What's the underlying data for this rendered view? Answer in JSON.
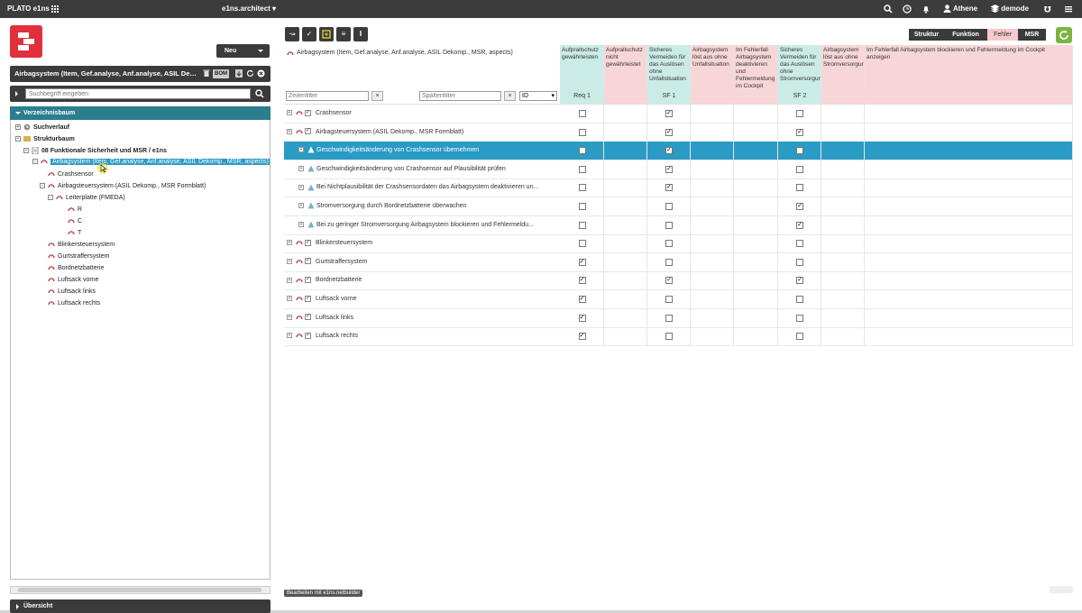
{
  "topbar": {
    "app_name": "PLATO e1ns",
    "module": "e1ns.architect",
    "user": "Athene",
    "database": "demode"
  },
  "left": {
    "new_button": "Neu",
    "context_title": "Airbagsystem (Item, Gef.analyse, Anf.analyse, ASIL Dekomp., MSR, aspects)",
    "bom_label": "BOM",
    "search_placeholder": "Suchbegriff eingeben",
    "tree_header": "Verzeichnisbaum",
    "overview_label": "Übersicht",
    "tree": [
      {
        "label": "Suchverlauf",
        "bold": true
      },
      {
        "label": "Strukturbaum",
        "bold": true
      },
      {
        "label": "08 Funktionale Sicherheit und MSR / e1ns",
        "bold": true
      },
      {
        "label": "Airbagsystem (Item, Gef.analyse, Anf.analyse, ASIL Dekomp., MSR, aspects)",
        "bold": false
      },
      {
        "label": "Crashsensor",
        "bold": false
      },
      {
        "label": "Airbagsteuersystem (ASIL Dekomp., MSR Formblatt)",
        "bold": false
      },
      {
        "label": "Leiterplatte (FMEDA)",
        "bold": false
      },
      {
        "label": "R",
        "bold": false
      },
      {
        "label": "C",
        "bold": false
      },
      {
        "label": "T",
        "bold": false
      },
      {
        "label": "Blinkersteuersystem",
        "bold": false
      },
      {
        "label": "Gurtstraffersystem",
        "bold": false
      },
      {
        "label": "Bordnetzbatterie",
        "bold": false
      },
      {
        "label": "Luftsack vorne",
        "bold": false
      },
      {
        "label": "Luftsack links",
        "bold": false
      },
      {
        "label": "Luftsack rechts",
        "bold": false
      }
    ]
  },
  "views": [
    "Struktur",
    "Funktion",
    "Fehler",
    "MSR"
  ],
  "grid": {
    "title": "Airbagsystem (Item, Gef.analyse, Anf.analyse, ASIL Dekomp., MSR, aspects)",
    "row_filter_placeholder": "Zeilenfilter",
    "col_filter_placeholder": "Spaltenfilter",
    "id_select": "ID",
    "columns": [
      {
        "header": "Aufprallschutz gewährleisten",
        "tag": "Req 1",
        "color": "teal"
      },
      {
        "header": "Aufprallschutz nicht gewährleistet",
        "tag": "",
        "color": "pink"
      },
      {
        "header": "Sicheres Vermeiden für das Auslösen ohne Unfallsituation",
        "tag": "SF 1",
        "color": "teal"
      },
      {
        "header": "Airbagsystem löst aus ohne Unfallsituation",
        "tag": "",
        "color": "pink"
      },
      {
        "header": "Im Fehlerfall Airbagsystem deaktivieren und Fehlermeldung im Cockpit anzeigen",
        "tag": "",
        "color": "pink"
      },
      {
        "header": "Sicheres Vermeiden für das Auslösen ohne Stromversorgung",
        "tag": "SF 2",
        "color": "teal"
      },
      {
        "header": "Airbagsystem löst aus ohne Stromversorgung",
        "tag": "",
        "color": "pink"
      },
      {
        "header": "Im Fehlerfall Airbagsystem blockieren und Fehlermeldung im Cockpit anzeigen",
        "tag": "",
        "color": "pink"
      }
    ],
    "rows": [
      {
        "label": "Crashsensor",
        "type": "item",
        "indent": 0,
        "checks": [
          false,
          null,
          true,
          null,
          null,
          false,
          null,
          null
        ]
      },
      {
        "label": "Airbagsteuersystem (ASIL Dekomp., MSR Formblatt)",
        "type": "item",
        "indent": 0,
        "checks": [
          false,
          null,
          true,
          null,
          null,
          true,
          null,
          null
        ]
      },
      {
        "label": "Geschwindigkeitsänderung von Crashsensor übernehmen",
        "type": "req",
        "indent": 1,
        "selected": true,
        "checks": [
          false,
          null,
          true,
          null,
          null,
          false,
          null,
          null
        ]
      },
      {
        "label": "Geschwindigkeitsänderung von Crashsensor auf Plausibilität prüfen",
        "type": "req",
        "indent": 1,
        "checks": [
          false,
          null,
          true,
          null,
          null,
          false,
          null,
          null
        ]
      },
      {
        "label": "Bei Nichtplausibilität der Crashsensordaten das Airbagsystem deaktivieren un...",
        "type": "req",
        "indent": 1,
        "checks": [
          false,
          null,
          true,
          null,
          null,
          false,
          null,
          null
        ]
      },
      {
        "label": "Stromversorgung durch Bordnetzbatterie überwachen",
        "type": "req",
        "indent": 1,
        "checks": [
          false,
          null,
          false,
          null,
          null,
          true,
          null,
          null
        ]
      },
      {
        "label": "Bei zu geringer Stromversorgung Airbagsystem blockieren und Fehlermeldu...",
        "type": "req",
        "indent": 1,
        "checks": [
          false,
          null,
          false,
          null,
          null,
          true,
          null,
          null
        ]
      },
      {
        "label": "Blinkersteuersystem",
        "type": "item",
        "indent": 0,
        "checks": [
          false,
          null,
          false,
          null,
          null,
          false,
          null,
          null
        ]
      },
      {
        "label": "Gurtstraffersystem",
        "type": "item",
        "indent": 0,
        "checks": [
          true,
          null,
          false,
          null,
          null,
          false,
          null,
          null
        ]
      },
      {
        "label": "Bordnetzbatterie",
        "type": "item",
        "indent": 0,
        "checks": [
          true,
          null,
          true,
          null,
          null,
          true,
          null,
          null
        ]
      },
      {
        "label": "Luftsack vorne",
        "type": "item",
        "indent": 0,
        "checks": [
          true,
          null,
          false,
          null,
          null,
          false,
          null,
          null
        ]
      },
      {
        "label": "Luftsack links",
        "type": "item",
        "indent": 0,
        "checks": [
          true,
          null,
          false,
          null,
          null,
          false,
          null,
          null
        ]
      },
      {
        "label": "Luftsack rechts",
        "type": "item",
        "indent": 0,
        "checks": [
          true,
          null,
          false,
          null,
          null,
          false,
          null,
          null
        ]
      }
    ]
  },
  "status": "Bearbeiten mit e1ns.netbuilder",
  "colors": {
    "accent": "#2a9bc4",
    "brand": "#e0303d",
    "teal": "#cbece6",
    "pink": "#f8d6d7",
    "dark": "#3b3b3b"
  }
}
